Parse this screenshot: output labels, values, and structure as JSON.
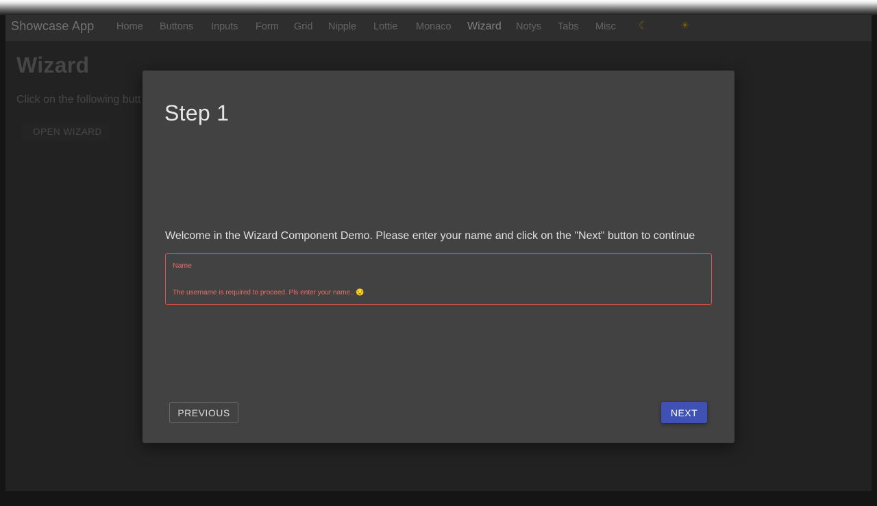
{
  "navbar": {
    "brand": "Showcase App",
    "items": [
      {
        "label": "Home"
      },
      {
        "label": "Buttons"
      },
      {
        "label": "Inputs"
      },
      {
        "label": "Form"
      },
      {
        "label": "Grid"
      },
      {
        "label": "Nipple"
      },
      {
        "label": "Lottie"
      },
      {
        "label": "Monaco"
      },
      {
        "label": "Wizard",
        "active": true
      },
      {
        "label": "Notys"
      },
      {
        "label": "Tabs"
      },
      {
        "label": "Misc"
      }
    ],
    "theme_dark_icon": "☾",
    "theme_light_icon": "☀"
  },
  "page": {
    "title": "Wizard",
    "description": "Click on the following butt",
    "open_button": "OPEN WIZARD"
  },
  "wizard": {
    "step_title": "Step 1",
    "welcome_text": "Welcome in the Wizard Component Demo. Please enter your name and click on the \"Next\" button to continue",
    "name_field": {
      "label": "Name",
      "value": "",
      "error": "The username is required to proceed. Pls enter your name.. 😒"
    },
    "previous_label": "PREVIOUS",
    "next_label": "NEXT"
  },
  "colors": {
    "accent": "#3f51b5",
    "error": "#e05252",
    "modal_bg": "#424242"
  }
}
